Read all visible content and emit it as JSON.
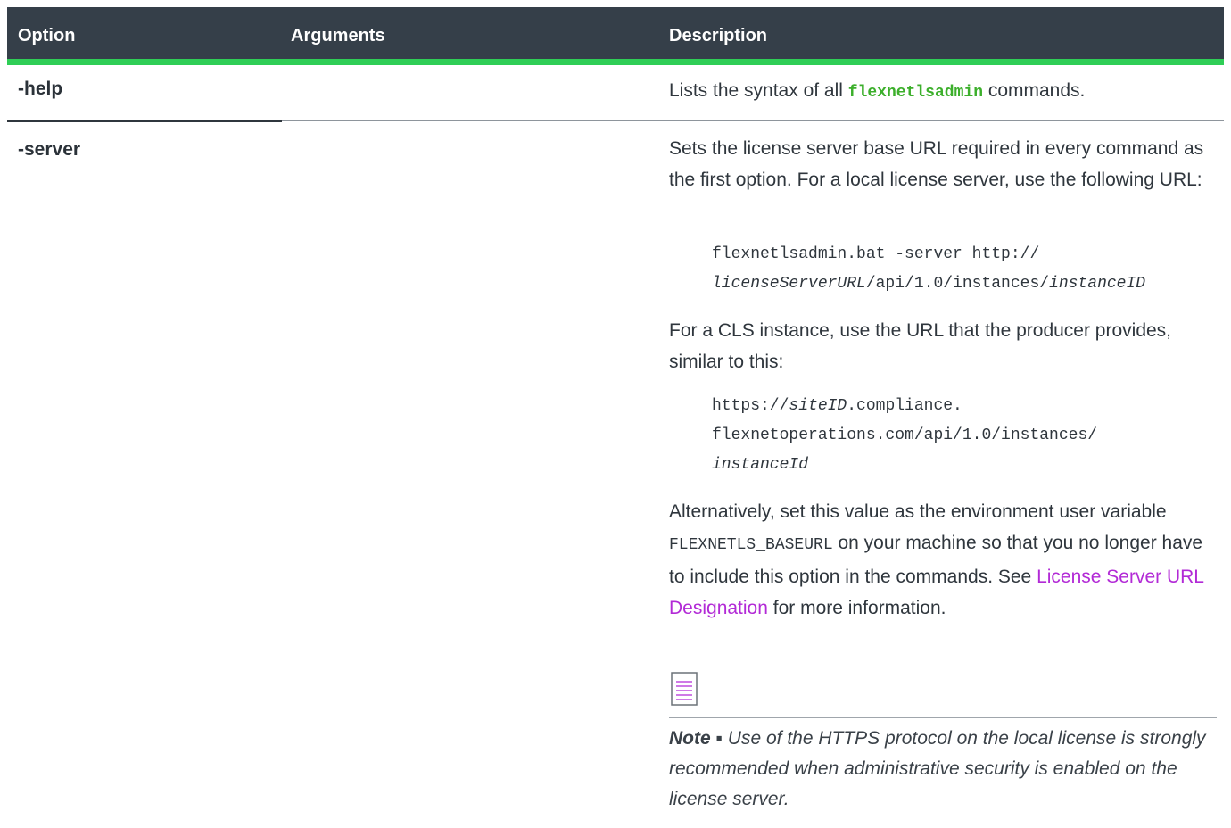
{
  "header": {
    "col1": "Option",
    "col2": "Arguments",
    "col3": "Description"
  },
  "rows": [
    {
      "option": "-help",
      "desc_pre": "Lists the syntax of all ",
      "desc_code": "flexnetlsadmin",
      "desc_post": " commands."
    },
    {
      "option": "-server",
      "para1": "Sets the license server base URL required in every command as the first option. For a local license server, use the following URL:",
      "code1_line1": "flexnetlsadmin.bat -server http://",
      "code1_line2_italic1": "licenseServerURL",
      "code1_line2_mid": "/api/1.0/instances/",
      "code1_line2_italic2": "instanceID",
      "para2": "For a CLS instance, use the URL that the producer provides, similar to this:",
      "code2_line1_pre": "https://",
      "code2_line1_italic": "siteID",
      "code2_line1_post": ".compliance.",
      "code2_line2": "flexnetoperations.com/api/1.0/instances/",
      "code2_line3_italic": "instanceId",
      "para3_pre": "Alternatively, set this value as the environment user variable ",
      "para3_code": "FLEXNETLS_BASEURL",
      "para3_mid": " on your machine so that you no longer have to include this option in the commands. See ",
      "para3_link": "License Server URL Designation",
      "para3_post": " for more information.",
      "note_label": "Note",
      "note_sep": " ▪ ",
      "note_text": "Use of the HTTPS protocol on the local license is strongly recommended when administrative security is enabled on the license server."
    }
  ],
  "colors": {
    "header_bg": "#353f49",
    "header_accent": "#2fce56",
    "code_green": "#3caf2b",
    "link": "#b22ad6"
  },
  "icons": {
    "note": "note-page-icon"
  }
}
